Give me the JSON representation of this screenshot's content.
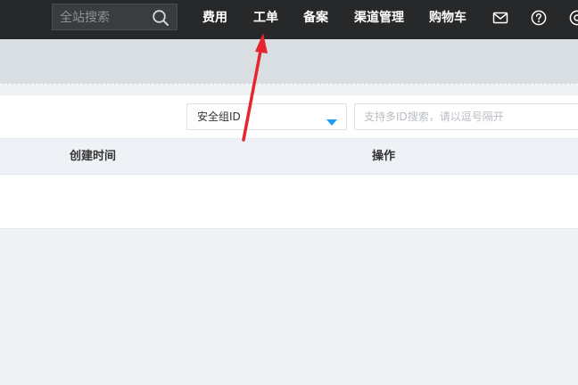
{
  "topbar": {
    "search": {
      "placeholder": "全站搜索",
      "icon": "search-icon"
    },
    "nav": [
      {
        "label": "费用"
      },
      {
        "label": "工单"
      },
      {
        "label": "备案"
      },
      {
        "label": "渠道管理"
      },
      {
        "label": "购物车"
      }
    ],
    "icons": [
      "mail-icon",
      "help-icon",
      "settings-icon"
    ]
  },
  "filter": {
    "select": {
      "value": "安全组ID"
    },
    "input": {
      "placeholder": "支持多ID搜索，请以逗号隔开"
    }
  },
  "table": {
    "columns": [
      {
        "label": "创建时间"
      },
      {
        "label": "操作"
      }
    ]
  },
  "colors": {
    "topbar_bg": "#262829",
    "banner_bg": "#d9dee2",
    "caret": "#1e9ff2",
    "annotation_arrow": "#e5262f"
  }
}
